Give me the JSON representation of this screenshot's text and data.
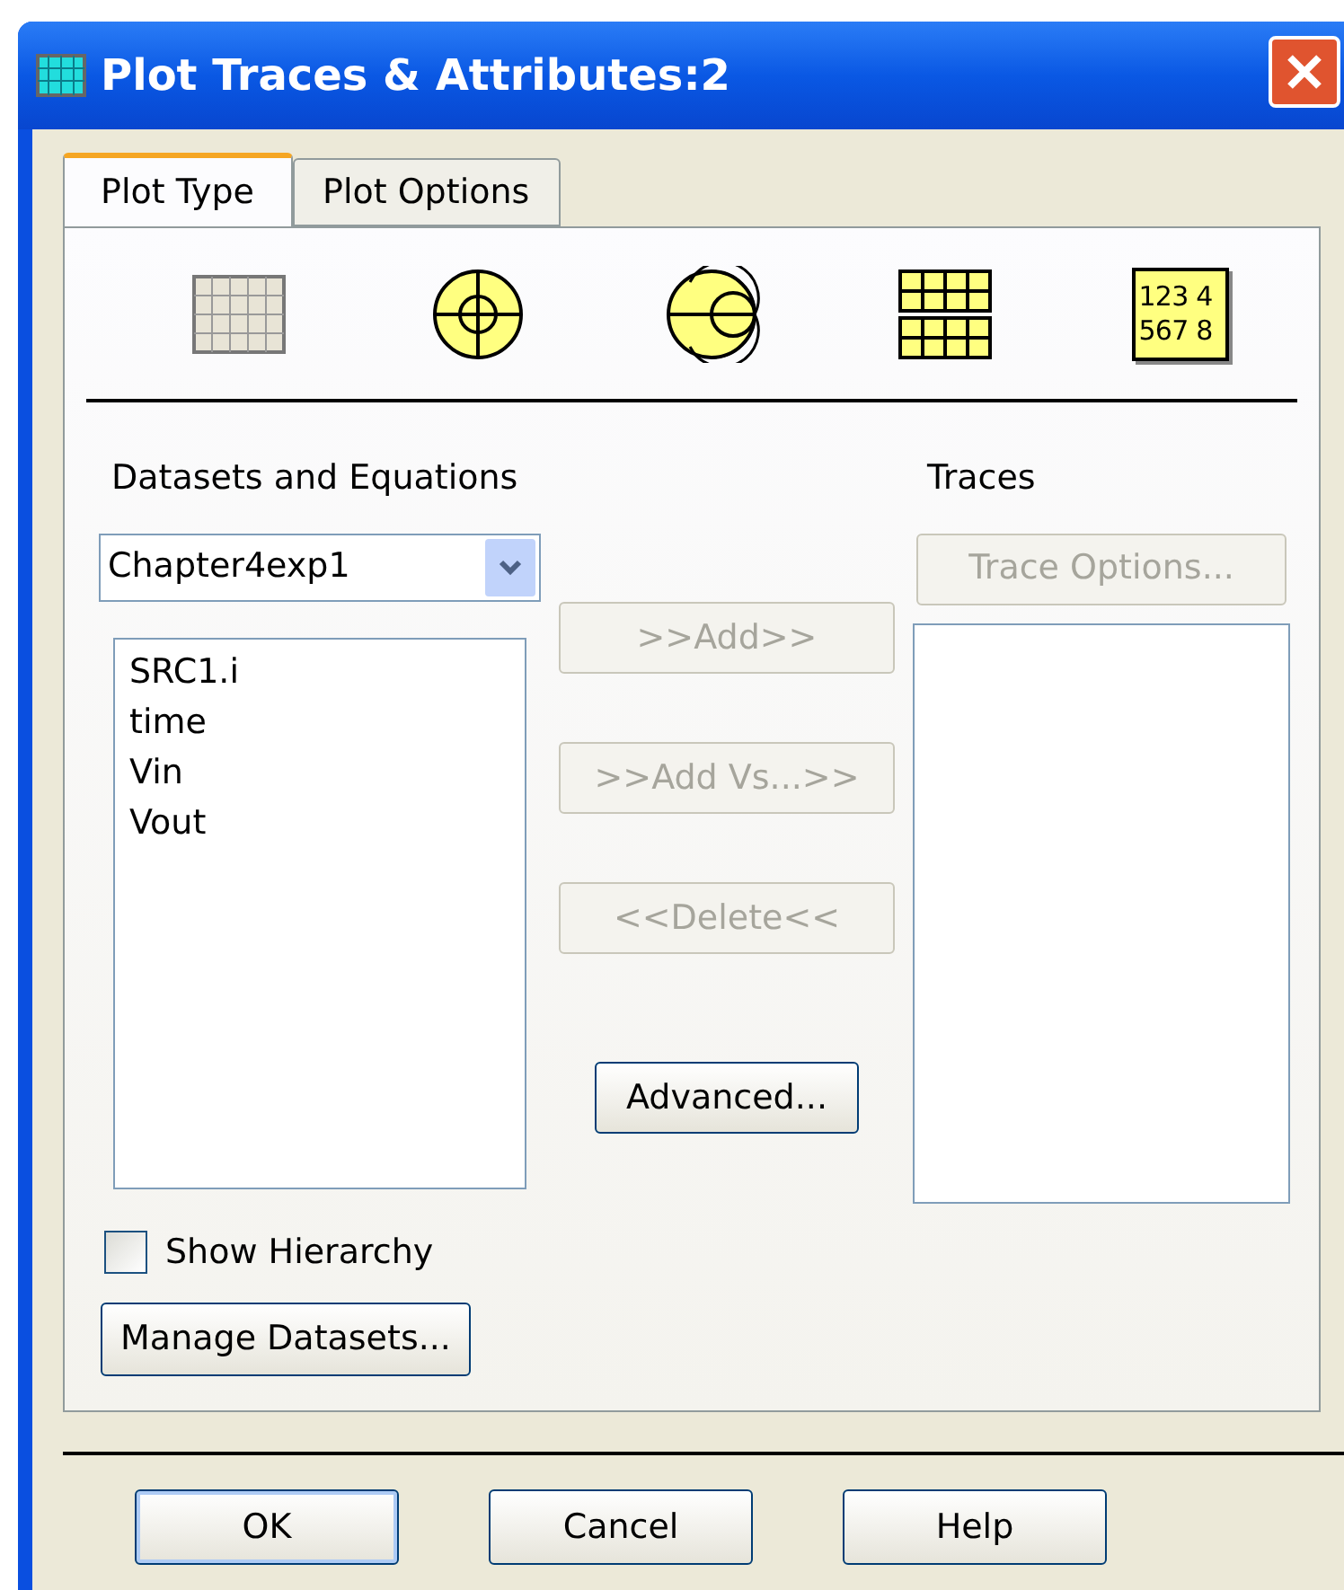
{
  "window": {
    "title": "Plot Traces & Attributes:2"
  },
  "tabs": [
    {
      "label": "Plot Type",
      "selected": true
    },
    {
      "label": "Plot Options",
      "selected": false
    }
  ],
  "plot_types": [
    {
      "kind": "rectangular"
    },
    {
      "kind": "polar"
    },
    {
      "kind": "smith"
    },
    {
      "kind": "stacked"
    },
    {
      "kind": "tabular",
      "lines": [
        "123 4",
        "567 8"
      ]
    }
  ],
  "datasets": {
    "label": "Datasets and Equations",
    "selected_dataset": "Chapter4exp1",
    "items": [
      "SRC1.i",
      "time",
      "Vin",
      "Vout"
    ]
  },
  "traces": {
    "label": "Traces",
    "options_button": {
      "label": "Trace Options...",
      "disabled": true
    }
  },
  "middle_buttons": [
    {
      "label": ">>Add>>",
      "disabled": true
    },
    {
      "label": ">>Add Vs...>>",
      "disabled": true
    },
    {
      "label": "<<Delete<<",
      "disabled": true
    },
    {
      "label": "Advanced...",
      "disabled": false
    }
  ],
  "show_hierarchy": {
    "label": "Show Hierarchy",
    "checked": false
  },
  "manage_button": "Manage Datasets...",
  "footer_buttons": [
    {
      "label": "OK",
      "default": true
    },
    {
      "label": "Cancel",
      "default": false
    },
    {
      "label": "Help",
      "default": false
    }
  ]
}
